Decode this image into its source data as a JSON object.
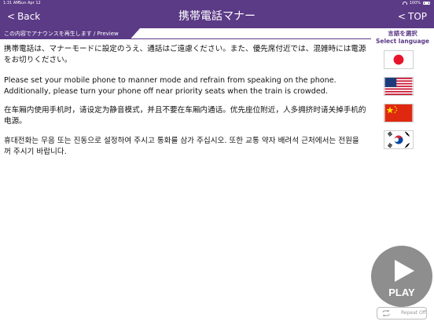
{
  "status_bar": {
    "time": "1:31 AM",
    "date": "Sun Apr 12",
    "battery": "100%"
  },
  "nav": {
    "back_label": "Back",
    "title": "携帯電話マナー",
    "top_label": "TOP"
  },
  "preview": {
    "label": "この内容でアナウンスを再生します / Preview"
  },
  "language_selector": {
    "title_ja": "言語を選択",
    "title_en": "Select language",
    "languages": [
      "japanese",
      "english",
      "chinese",
      "korean"
    ]
  },
  "announcements": {
    "ja": "携帯電話は、マナーモードに設定のうえ、通話はご遠慮ください。また、優先席付近では、混雑時には電源をお切りください。",
    "en": "Please set your mobile phone to manner mode and refrain from speaking on the phone. Additionally, please turn your phone off near priority seats when the train is crowded.",
    "zh": "在车厢内使用手机时，请设定为静音模式，并且不要在车厢内通话。优先座位附近，人多拥挤时请关掉手机的电源。",
    "ko": "휴대전화는 무음 또는 진동으로 설정하여 주시고 통화를 삼가 주십시오. 또한 교통 약자 배려석 근처에서는 전원을 꺼 주시기 바랍니다."
  },
  "player": {
    "play_label": "PLAY",
    "repeat_label": "Repeat Off"
  },
  "colors": {
    "brand_purple": "#5b3a86",
    "play_gray": "#8e8e8e"
  }
}
